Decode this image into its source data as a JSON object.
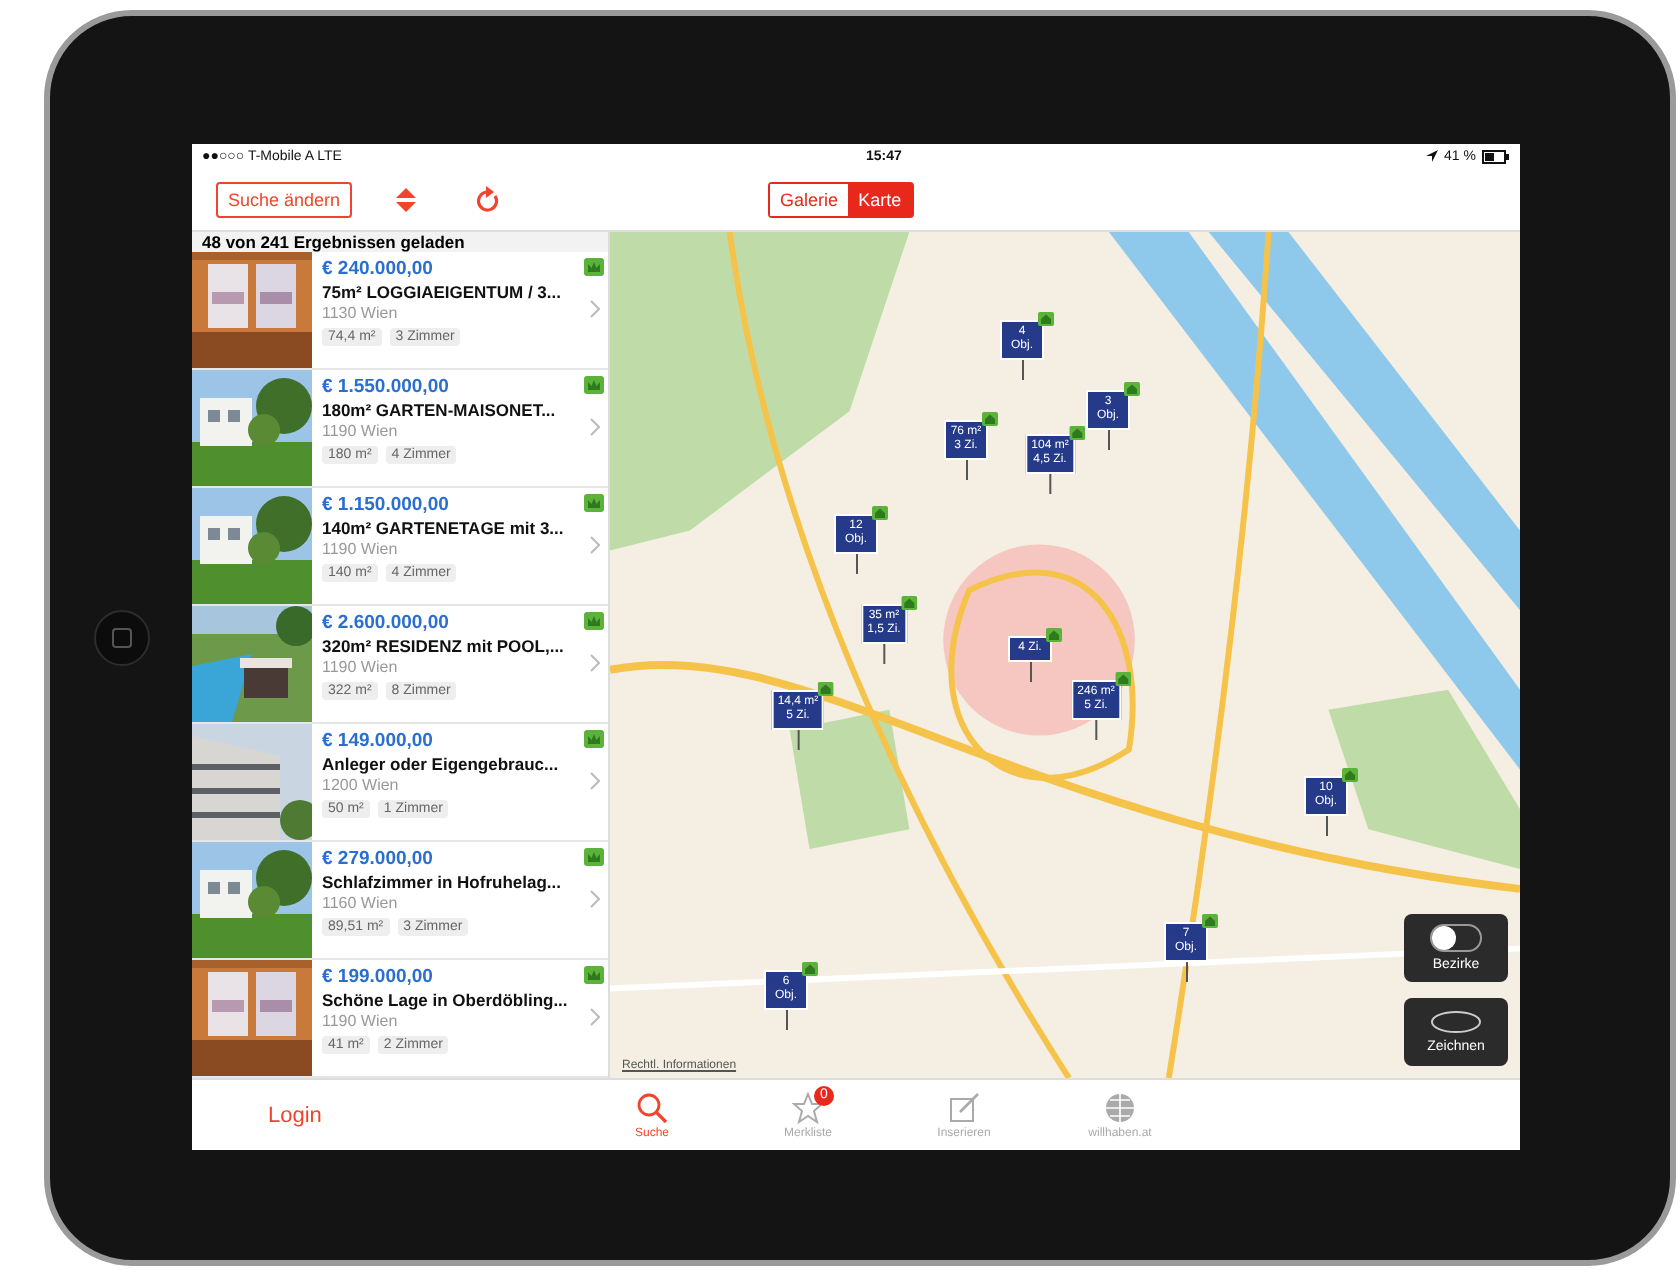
{
  "status_bar": {
    "carrier": "●●○○○ T-Mobile A  LTE",
    "time": "15:47",
    "battery": "41 %"
  },
  "toolbar": {
    "edit_button": "Suche ändern",
    "views": [
      {
        "label": "Galerie",
        "selected": false
      },
      {
        "label": "Karte",
        "selected": true
      }
    ]
  },
  "results_header": "48 von 241 Ergebnissen geladen",
  "listings": [
    {
      "price": "€ 240.000,00",
      "title": "75m² LOGGIAEIGENTUM / 3...",
      "location": "1130 Wien",
      "area": "74,4 m²",
      "rooms": "3 Zimmer",
      "premium": true,
      "kind": "interior"
    },
    {
      "price": "€ 1.550.000,00",
      "title": "180m² GARTEN-MAISONET...",
      "location": "1190 Wien",
      "area": "180 m²",
      "rooms": "4 Zimmer",
      "premium": true,
      "kind": "house"
    },
    {
      "price": "€ 1.150.000,00",
      "title": "140m² GARTENETAGE mit 3...",
      "location": "1190 Wien",
      "area": "140 m²",
      "rooms": "4 Zimmer",
      "premium": true,
      "kind": "house"
    },
    {
      "price": "€ 2.600.000,00",
      "title": "320m² RESIDENZ mit POOL,...",
      "location": "1190 Wien",
      "area": "322 m²",
      "rooms": "8 Zimmer",
      "premium": true,
      "kind": "pool"
    },
    {
      "price": "€ 149.000,00",
      "title": "Anleger oder Eigengebrauc...",
      "location": "1200 Wien",
      "area": "50 m²",
      "rooms": "1 Zimmer",
      "premium": true,
      "kind": "building"
    },
    {
      "price": "€ 279.000,00",
      "title": "Schlafzimmer in Hofruhelag...",
      "location": "1160 Wien",
      "area": "89,51 m²",
      "rooms": "3 Zimmer",
      "premium": true,
      "kind": "house"
    },
    {
      "price": "€ 199.000,00",
      "title": "Schöne Lage in Oberdöbling...",
      "location": "1190 Wien",
      "area": "41 m²",
      "rooms": "2 Zimmer",
      "premium": true,
      "kind": "interior"
    }
  ],
  "map": {
    "legal_link": "Rechtl. Informationen",
    "markers": [
      {
        "lines": [
          "4",
          "Obj."
        ]
      },
      {
        "lines": [
          "3",
          "Obj."
        ]
      },
      {
        "lines": [
          "76 m²",
          "3 Zi."
        ]
      },
      {
        "lines": [
          "104 m²",
          "4,5 Zi."
        ]
      },
      {
        "lines": [
          "12",
          "Obj."
        ]
      },
      {
        "lines": [
          "35 m²",
          "1,5 Zi."
        ]
      },
      {
        "lines": [
          "4 Zi."
        ]
      },
      {
        "lines": [
          "246 m²",
          "5 Zi."
        ]
      },
      {
        "lines": [
          "14,4 m²",
          "5 Zi."
        ]
      },
      {
        "lines": [
          "10",
          "Obj."
        ]
      },
      {
        "lines": [
          "7",
          "Obj."
        ]
      },
      {
        "lines": [
          "6",
          "Obj."
        ]
      }
    ],
    "controls": [
      {
        "label": "Bezirke",
        "kind": "toggle",
        "on": false
      },
      {
        "label": "Zeichnen",
        "kind": "draw",
        "on": false
      }
    ]
  },
  "login": "Login",
  "tabs": [
    {
      "label": "Suche",
      "kind": "search",
      "selected": true
    },
    {
      "label": "Merkliste",
      "kind": "star",
      "selected": false,
      "badge": "0"
    },
    {
      "label": "Inserieren",
      "kind": "edit",
      "selected": false
    },
    {
      "label": "willhaben.at",
      "kind": "globe",
      "selected": false
    }
  ]
}
